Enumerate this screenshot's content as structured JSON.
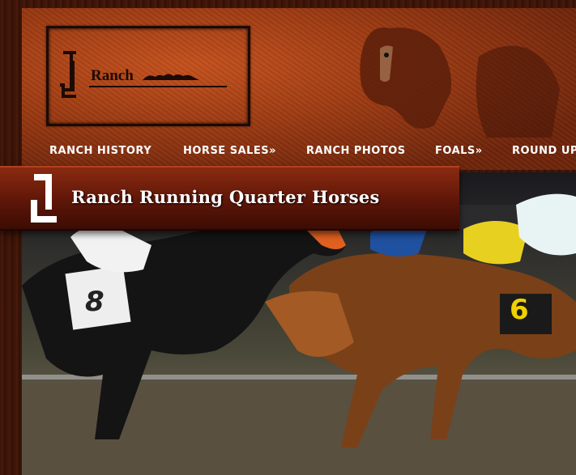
{
  "logo": {
    "text": "Ranch",
    "icon": "jl-brand-logo"
  },
  "nav": {
    "items": [
      {
        "label": "RANCH HISTORY"
      },
      {
        "label": "HORSE SALES»"
      },
      {
        "label": "RANCH PHOTOS"
      },
      {
        "label": "FOALS»"
      },
      {
        "label": "ROUND UP"
      }
    ]
  },
  "title": {
    "text": "Ranch Running Quarter Horses",
    "icon": "jl-brand-icon"
  },
  "photo": {
    "numbers": [
      "8",
      "6"
    ]
  },
  "colors": {
    "background": "#3a1408",
    "header": "#9c3a12",
    "title_bar": "#5e1608",
    "nav_text": "#ffffff"
  }
}
